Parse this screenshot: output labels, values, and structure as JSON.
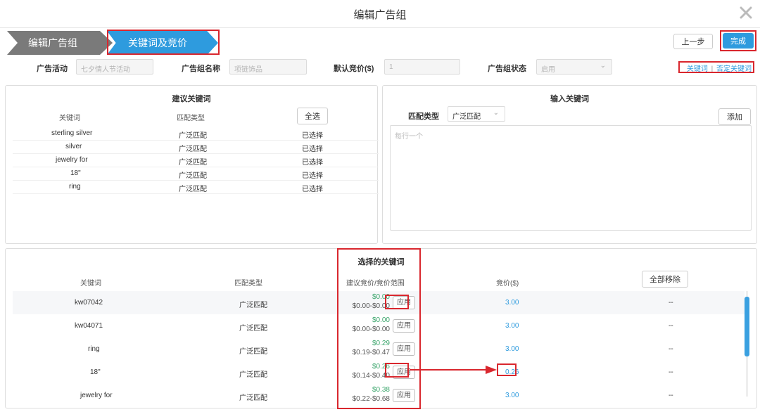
{
  "dialog": {
    "title": "编辑广告组"
  },
  "steps": [
    "编辑广告组",
    "关键词及竞价"
  ],
  "actions": {
    "prev": "上一步",
    "next": "完成"
  },
  "form": {
    "campaign_label": "广告活动",
    "campaign_value": "七夕情人节活动",
    "group_name_label": "广告组名称",
    "group_name_value": "项链饰品",
    "default_bid_label": "默认竞价($)",
    "default_bid_value": "1",
    "status_label": "广告组状态",
    "status_value": "启用"
  },
  "top_links": {
    "keywords": "关键词",
    "separator": "|",
    "negative": "否定关键词"
  },
  "suggested": {
    "title": "建议关键词",
    "col_keyword": "关键词",
    "col_match": "匹配类型",
    "select_all": "全选",
    "rows": [
      {
        "keyword": "sterling silver",
        "match": "广泛匹配",
        "status": "已选择"
      },
      {
        "keyword": "silver",
        "match": "广泛匹配",
        "status": "已选择"
      },
      {
        "keyword": "jewelry for",
        "match": "广泛匹配",
        "status": "已选择"
      },
      {
        "keyword": "18\"",
        "match": "广泛匹配",
        "status": "已选择"
      },
      {
        "keyword": "ring",
        "match": "广泛匹配",
        "status": "已选择"
      }
    ]
  },
  "input_kw": {
    "title": "输入关键词",
    "match_label": "匹配类型",
    "match_value": "广泛匹配",
    "add": "添加",
    "placeholder": "每行一个"
  },
  "selected": {
    "title": "选择的关键词",
    "col_keyword": "关键词",
    "col_match": "匹配类型",
    "col_suggest": "建议竞价/竞价范围",
    "col_bid": "竞价($)",
    "remove_all": "全部移除",
    "rows": [
      {
        "keyword": "kw07042",
        "match": "广泛匹配",
        "sug": "$0.00",
        "range": "$0.00-$0.00",
        "apply": "应用",
        "bid": "3.00",
        "action": "--"
      },
      {
        "keyword": "kw04071",
        "match": "广泛匹配",
        "sug": "$0.00",
        "range": "$0.00-$0.00",
        "apply": "应用",
        "bid": "3.00",
        "action": "--"
      },
      {
        "keyword": "ring",
        "match": "广泛匹配",
        "sug": "$0.29",
        "range": "$0.19-$0.47",
        "apply": "应用",
        "bid": "3.00",
        "action": "--"
      },
      {
        "keyword": "18\"",
        "match": "广泛匹配",
        "sug": "$0.26",
        "range": "$0.14-$0.40",
        "apply": "应用",
        "bid": "0.26",
        "action": "--"
      },
      {
        "keyword": "jewelry for",
        "match": "广泛匹配",
        "sug": "$0.38",
        "range": "$0.22-$0.68",
        "apply": "应用",
        "bid": "3.00",
        "action": "--"
      }
    ]
  },
  "colors": {
    "primary": "#2e9bde",
    "highlight": "#d9272e",
    "green": "#3aa56b",
    "step_inactive": "#7a7a7a"
  }
}
